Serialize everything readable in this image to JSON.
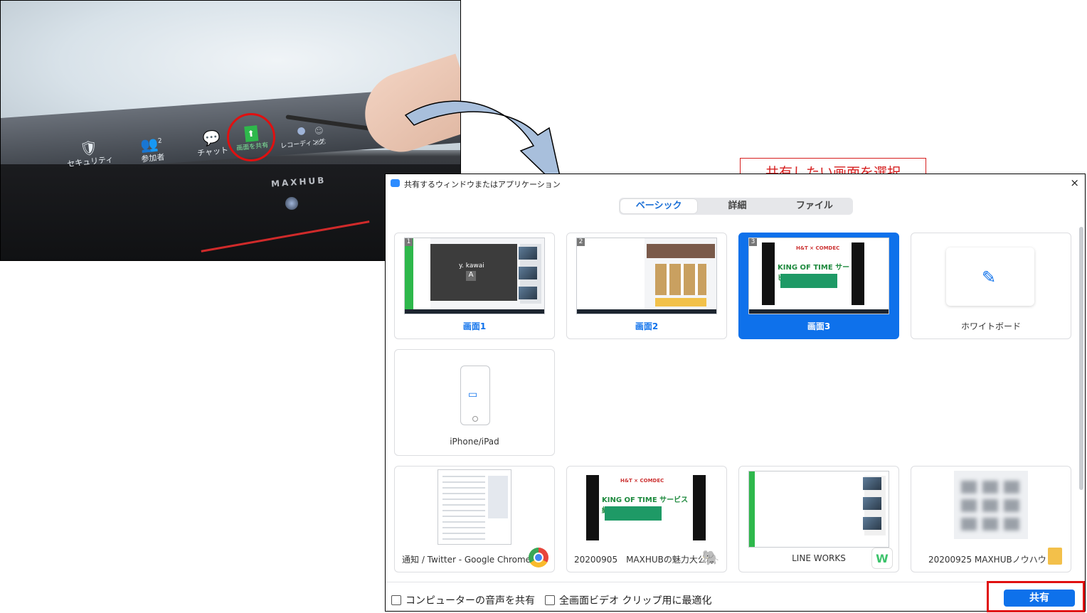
{
  "photo": {
    "toolbar": [
      {
        "label": "セキュリティ",
        "icon": "shield-icon",
        "glyph": "🛡"
      },
      {
        "label": "参加者",
        "icon": "participants-icon",
        "glyph": "👥",
        "badge": "2"
      },
      {
        "label": "チャット",
        "icon": "chat-icon",
        "glyph": "💬"
      },
      {
        "label": "画面を共有",
        "icon": "share-screen-icon",
        "glyph": "⬆"
      },
      {
        "label": "レコーディング",
        "icon": "record-icon",
        "glyph": "●"
      },
      {
        "label": "反応",
        "icon": "reaction-icon",
        "glyph": "☺"
      }
    ],
    "brand": "MAXHUB"
  },
  "dialog": {
    "title": "共有するウィンドウまたはアプリケーション",
    "close": "×",
    "tabs": [
      {
        "label": "ベーシック",
        "active": true
      },
      {
        "label": "詳細",
        "active": false
      },
      {
        "label": "ファイル",
        "active": false
      }
    ],
    "screens": [
      {
        "num": "1",
        "label": "画面1",
        "overlay_name": "y. kawai",
        "overlay_letter": "A"
      },
      {
        "num": "2",
        "label": "画面2"
      },
      {
        "num": "3",
        "label": "画面3",
        "selected": true,
        "kot_header": "H&T × COMDEC",
        "kot_logo": "KING OF TIME サービス紹介"
      },
      {
        "label": "ホワイトボード"
      }
    ],
    "device": {
      "label": "iPhone/iPad"
    },
    "apps": [
      {
        "label": "通知 / Twitter - Google Chrome",
        "badge_icon": "chrome-icon",
        "badge_color": "#e8453c"
      },
      {
        "label": "20200905　MAXHUBの魅力大公...",
        "badge_icon": "evernote-icon",
        "badge_color": "#2dbe60",
        "kot_header": "H&T × COMDEC",
        "kot_logo": "KING OF TIME サービス紹介"
      },
      {
        "label": "LINE WORKS",
        "badge_icon": "lineworks-icon",
        "badge_color": "#3cc36b",
        "badge_text": "W"
      },
      {
        "label": "20200925 MAXHUBノウハウ",
        "badge_icon": "folder-icon",
        "badge_color": "#f3c04a"
      }
    ],
    "footer": {
      "audio_checkbox": "コンピューターの音声を共有",
      "video_checkbox": "全画面ビデオ クリップ用に最適化",
      "share_button": "共有"
    }
  },
  "callout": {
    "text": "共有したい画面を選択"
  },
  "colors": {
    "accent": "#0e71eb",
    "highlight": "#e01010",
    "arrow": "#a8bfdc"
  }
}
